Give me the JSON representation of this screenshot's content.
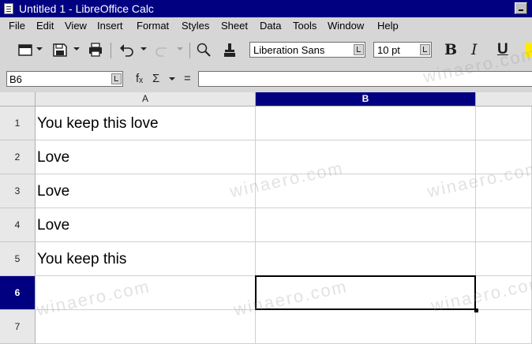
{
  "window": {
    "title": "Untitled 1 - LibreOffice Calc"
  },
  "menu": [
    "File",
    "Edit",
    "View",
    "Insert",
    "Format",
    "Styles",
    "Sheet",
    "Data",
    "Tools",
    "Window",
    "Help"
  ],
  "toolbar": {
    "font_name": "Liberation Sans",
    "font_size": "10 pt",
    "bold_label": "B",
    "italic_label": "I",
    "underline_label": "U",
    "icons": [
      "open-folder-icon",
      "save-icon",
      "print-icon",
      "undo-icon",
      "redo-icon",
      "find-icon",
      "clone-formatting-icon",
      "highlight-icon"
    ]
  },
  "formula_bar": {
    "name_box": "B6",
    "function_wizard_symbol": "fₓ",
    "sum_symbol": "Σ",
    "equals_symbol": "=",
    "formula": ""
  },
  "sheet": {
    "columns": [
      "A",
      "B"
    ],
    "selected_column": "B",
    "rows": [
      {
        "number": "1",
        "a": "You keep this love",
        "b": ""
      },
      {
        "number": "2",
        "a": "Love",
        "b": ""
      },
      {
        "number": "3",
        "a": "Love",
        "b": ""
      },
      {
        "number": "4",
        "a": "Love",
        "b": ""
      },
      {
        "number": "5",
        "a": "You keep this",
        "b": ""
      },
      {
        "number": "6",
        "a": "",
        "b": ""
      },
      {
        "number": "7",
        "a": "",
        "b": ""
      }
    ],
    "selected_row": "6",
    "active_cell": "B6"
  },
  "watermark": "winaero.com",
  "colors": {
    "titlebar": "#000080",
    "selected_header": "#000080"
  }
}
